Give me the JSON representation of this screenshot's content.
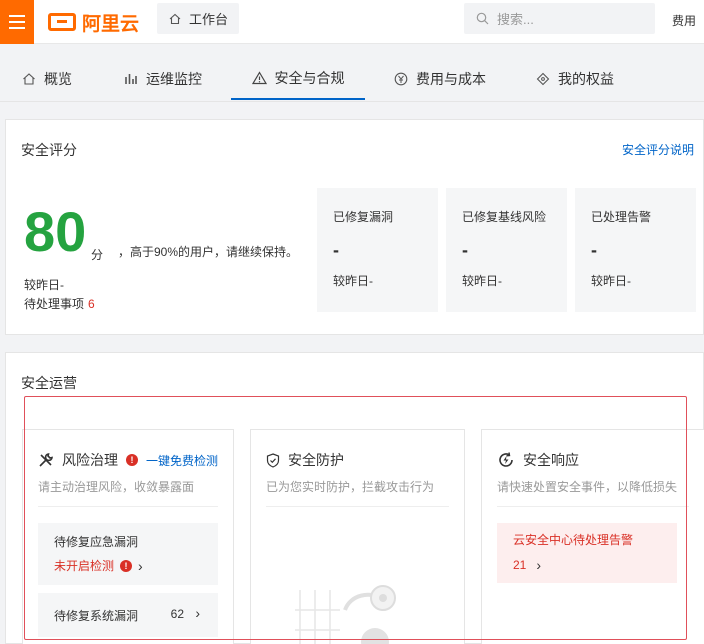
{
  "topbar": {
    "logo_text": "阿里云",
    "workbench_label": "工作台",
    "search_placeholder": "搜索...",
    "fee_label": "费用"
  },
  "tabs": [
    {
      "label": "概览",
      "icon": "home-icon"
    },
    {
      "label": "运维监控",
      "icon": "bar-chart-icon"
    },
    {
      "label": "安全与合规",
      "icon": "warning-icon",
      "active": true
    },
    {
      "label": "费用与成本",
      "icon": "yuan-icon"
    },
    {
      "label": "我的权益",
      "icon": "diamond-icon"
    }
  ],
  "score": {
    "title": "安全评分",
    "help_link": "安全评分说明",
    "value": "80",
    "unit": "分",
    "description": "，高于90%的用户，请继续保持。",
    "compare": "较昨日-",
    "pending_label": "待处理事项",
    "pending_count": "6",
    "stats": [
      {
        "label": "已修复漏洞",
        "value": "-",
        "compare": "较昨日-"
      },
      {
        "label": "已修复基线风险",
        "value": "-",
        "compare": "较昨日-"
      },
      {
        "label": "已处理告警",
        "value": "-",
        "compare": "较昨日-"
      }
    ]
  },
  "ops": {
    "title": "安全运营",
    "risk": {
      "title": "风险治理",
      "free_check": "一键免费检测",
      "desc": "请主动治理风险，收敛暴露面",
      "emergency_label": "待修复应急漏洞",
      "emergency_status": "未开启检测",
      "system_label": "待修复系统漏洞",
      "system_count": "62"
    },
    "protection": {
      "title": "安全防护",
      "desc": "已为您实时防护，拦截攻击行为"
    },
    "response": {
      "title": "安全响应",
      "desc": "请快速处置安全事件，以降低损失",
      "alarm_label": "云安全中心待处理告警",
      "alarm_count": "21"
    }
  },
  "colors": {
    "brand": "#ff6a00",
    "accent": "#0064c8",
    "score_green": "#25a340",
    "danger": "#d93026"
  }
}
